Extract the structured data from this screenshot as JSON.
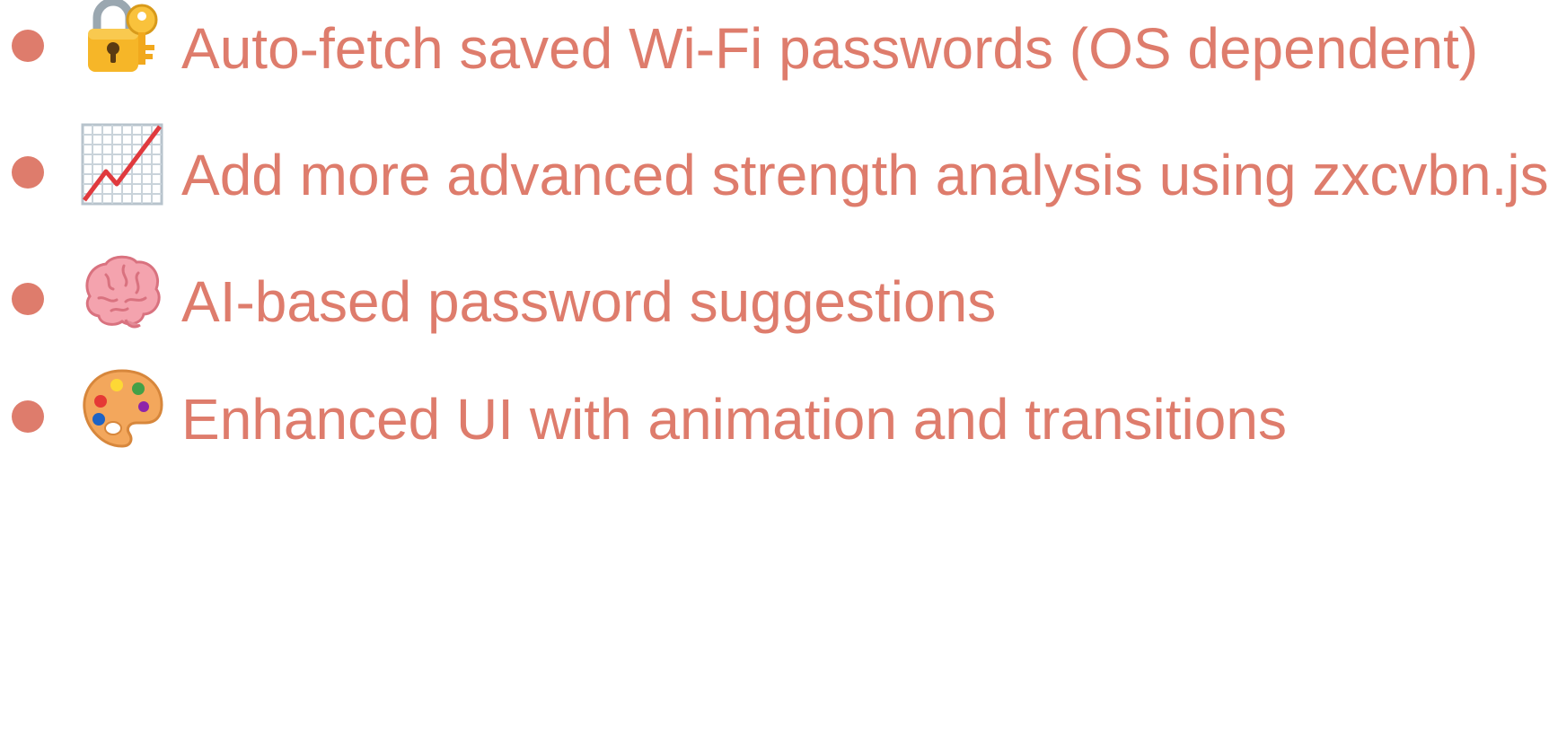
{
  "colors": {
    "text": "#de7c6c",
    "bullet": "#de7c6c"
  },
  "items": [
    {
      "icon": "locked-with-key-icon",
      "text": "Auto-fetch saved Wi-Fi passwords (OS dependent)"
    },
    {
      "icon": "chart-increasing-icon",
      "text": "Add more advanced strength analysis using zxcvbn.js"
    },
    {
      "icon": "brain-icon",
      "text": "AI-based password suggestions"
    },
    {
      "icon": "artist-palette-icon",
      "text": "Enhanced UI with animation and transitions"
    }
  ]
}
